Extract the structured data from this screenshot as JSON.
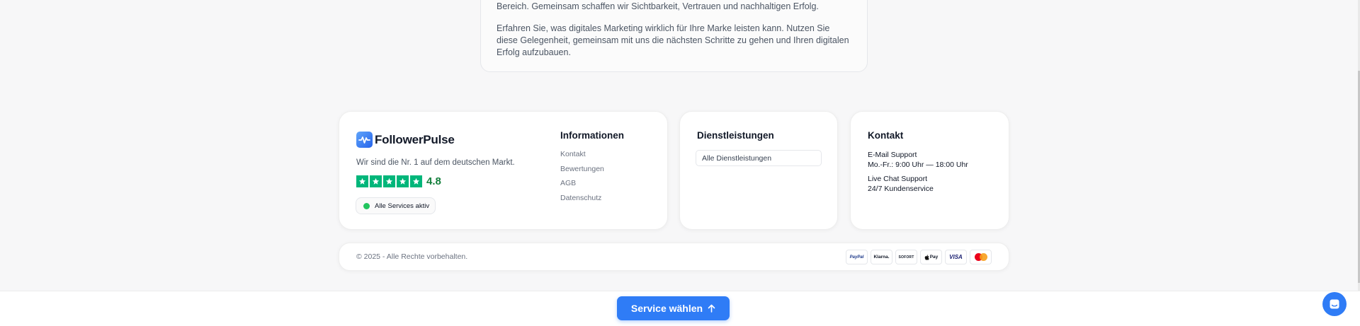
{
  "intro": {
    "para1": "Bereich. Gemeinsam schaffen wir Sichtbarkeit, Vertrauen und nachhaltigen Erfolg.",
    "para2": "Erfahren Sie, was digitales Marketing wirklich für Ihre Marke leisten kann. Nutzen Sie diese Gelegenheit, gemeinsam mit uns die nächsten Schritte zu gehen und Ihren digitalen Erfolg aufzubauen."
  },
  "brand": {
    "name": "FollowerPulse",
    "logo_icon": "pulse-icon",
    "tagline": "Wir sind die Nr. 1 auf dem deutschen Markt.",
    "rating_value": "4.8",
    "rating_stars": 5,
    "status_text": "Alle Services aktiv",
    "colors": {
      "accent": "#2f7cf6",
      "star": "#00b67a",
      "rating": "#15803d",
      "status": "#22c55e"
    }
  },
  "info": {
    "title": "Informationen",
    "links": [
      "Kontakt",
      "Bewertungen",
      "AGB",
      "Datenschutz"
    ]
  },
  "services": {
    "title": "Dienstleistungen",
    "item": "Alle Dienstleistungen"
  },
  "contact": {
    "title": "Kontakt",
    "email_label": "E-Mail Support",
    "email_hours": "Mo.-Fr.: 9:00 Uhr — 18:00 Uhr",
    "chat_label": "Live Chat Support",
    "chat_hours": "24/7 Kundenservice"
  },
  "footer": {
    "copyright": "© 2025 - Alle Rechte vorbehalten.",
    "payments": [
      {
        "label": "PayPal",
        "icon": "paypal-icon"
      },
      {
        "label": "Klarna.",
        "icon": "klarna-icon"
      },
      {
        "label": "SOFORT",
        "icon": "sofort-icon"
      },
      {
        "label": "Pay",
        "icon": "apple-pay-icon"
      },
      {
        "label": "VISA",
        "icon": "visa-icon"
      },
      {
        "label": "",
        "icon": "mastercard-icon"
      }
    ]
  },
  "cta": {
    "label": "Service wählen",
    "icon": "arrow-up-icon",
    "chat_icon": "chat-icon"
  }
}
